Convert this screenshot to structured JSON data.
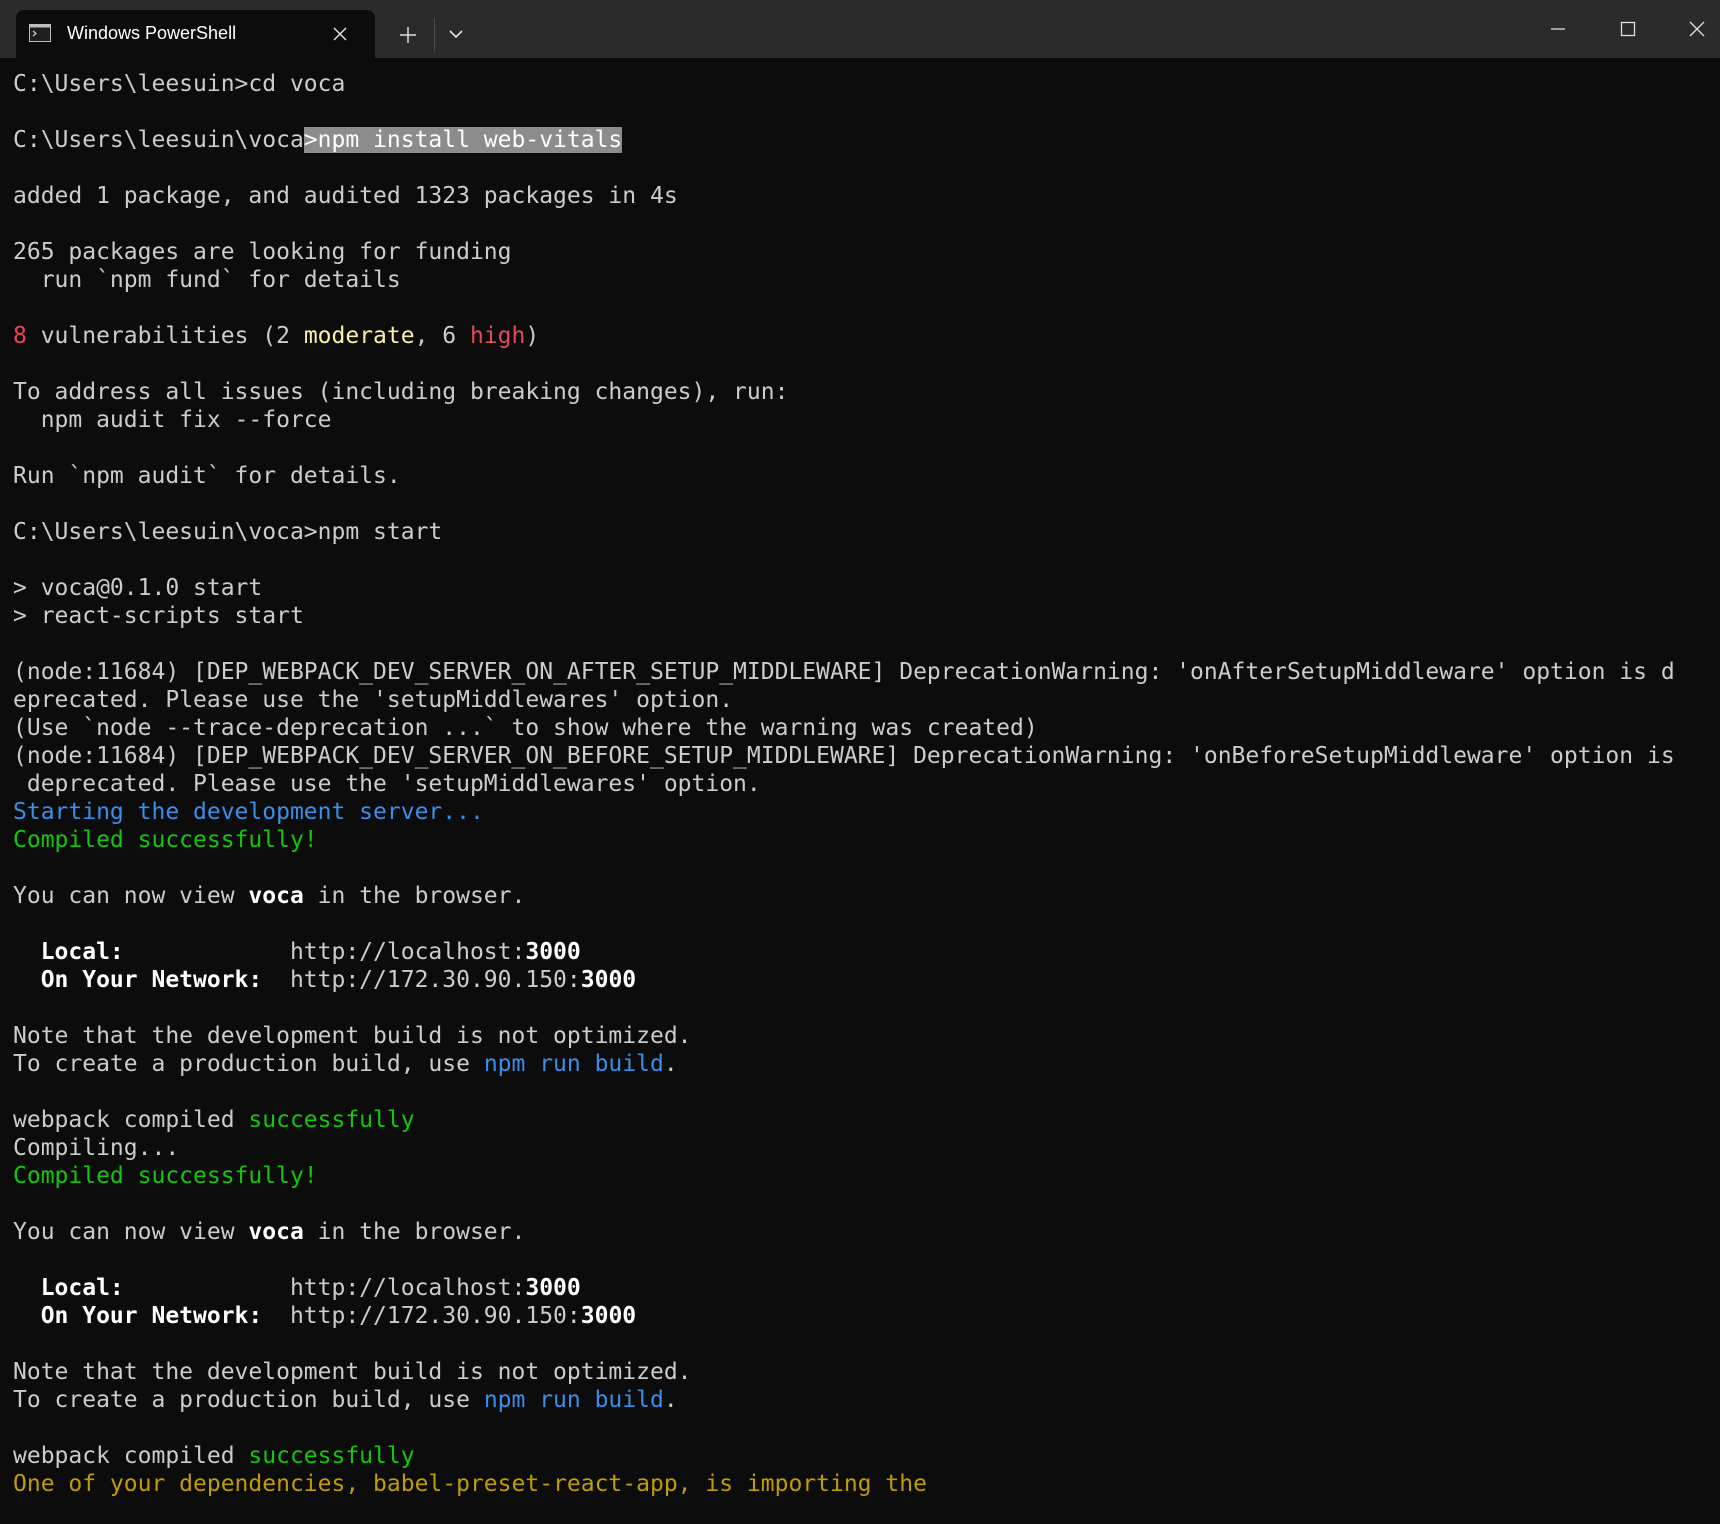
{
  "window": {
    "tab_title": "Windows PowerShell",
    "icons": {
      "tab_icon": "terminal-icon",
      "tab_close": "close-icon",
      "new_tab": "plus-icon",
      "dropdown": "chevron-down-icon",
      "minimize": "minimize-icon",
      "maximize": "maximize-icon",
      "close": "close-icon"
    }
  },
  "colors": {
    "background": "#0c0c0c",
    "titlebar": "#2b2b2b",
    "text": "#cccccc",
    "error_red": "#e74856",
    "warning_yellow": "#f9f1a5",
    "info_blue": "#3b8eea",
    "success_green": "#16c60c",
    "notice_orange": "#c19c00",
    "selection": "#8c8c8c"
  },
  "terminal": {
    "l01": "C:\\Users\\leesuin>cd voca",
    "l03a": "C:\\Users\\leesuin\\voca",
    "l03b": ">npm install web-vitals",
    "l05": "added 1 package, and audited 1323 packages in 4s",
    "l07": "265 packages are looking for funding",
    "l08": "  run `npm fund` for details",
    "l10a": "8",
    "l10b": " vulnerabilities (2 ",
    "l10c": "moderate",
    "l10d": ", 6 ",
    "l10e": "high",
    "l10f": ")",
    "l12": "To address all issues (including breaking changes), run:",
    "l13": "  npm audit fix --force",
    "l15": "Run `npm audit` for details.",
    "l17": "C:\\Users\\leesuin\\voca>npm start",
    "l19": "> voca@0.1.0 start",
    "l20": "> react-scripts start",
    "l22": "(node:11684) [DEP_WEBPACK_DEV_SERVER_ON_AFTER_SETUP_MIDDLEWARE] DeprecationWarning: 'onAfterSetupMiddleware' option is d",
    "l23": "eprecated. Please use the 'setupMiddlewares' option.",
    "l24": "(Use `node --trace-deprecation ...` to show where the warning was created)",
    "l25": "(node:11684) [DEP_WEBPACK_DEV_SERVER_ON_BEFORE_SETUP_MIDDLEWARE] DeprecationWarning: 'onBeforeSetupMiddleware' option is",
    "l26": " deprecated. Please use the 'setupMiddlewares' option.",
    "l27": "Starting the development server...",
    "l28": "Compiled successfully!",
    "l30a": "You can now view ",
    "l30b": "voca",
    "l30c": " in the browser.",
    "l32a": "  Local:",
    "l32b": "            http://localhost:",
    "l32c": "3000",
    "l33a": "  On Your Network:",
    "l33b": "  http://172.30.90.150:",
    "l33c": "3000",
    "l35": "Note that the development build is not optimized.",
    "l36a": "To create a production build, use ",
    "l36b": "npm run build",
    "l36c": ".",
    "l38a": "webpack compiled ",
    "l38b": "successfully",
    "l39": "Compiling...",
    "l40": "Compiled successfully!",
    "l42a": "You can now view ",
    "l42b": "voca",
    "l42c": " in the browser.",
    "l44a": "  Local:",
    "l44b": "            http://localhost:",
    "l44c": "3000",
    "l45a": "  On Your Network:",
    "l45b": "  http://172.30.90.150:",
    "l45c": "3000",
    "l47": "Note that the development build is not optimized.",
    "l48a": "To create a production build, use ",
    "l48b": "npm run build",
    "l48c": ".",
    "l50a": "webpack compiled ",
    "l50b": "successfully",
    "l51": "One of your dependencies, babel-preset-react-app, is importing the"
  }
}
